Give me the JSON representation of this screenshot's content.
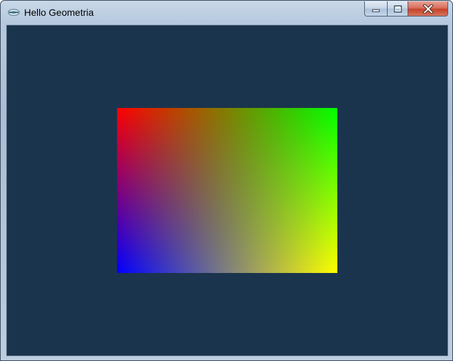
{
  "window": {
    "title": "Hello Geometria",
    "app_icon": "app-icon",
    "caption_buttons": {
      "minimize_icon": "minimize-icon",
      "maximize_icon": "maximize-icon",
      "close_icon": "close-icon"
    }
  },
  "client": {
    "background_color": "#1b344d",
    "quad": {
      "corner_colors": {
        "top_left": "#ff0000",
        "top_right": "#00ff00",
        "bottom_left": "#0000ff",
        "bottom_right": "#ffff00"
      }
    }
  }
}
